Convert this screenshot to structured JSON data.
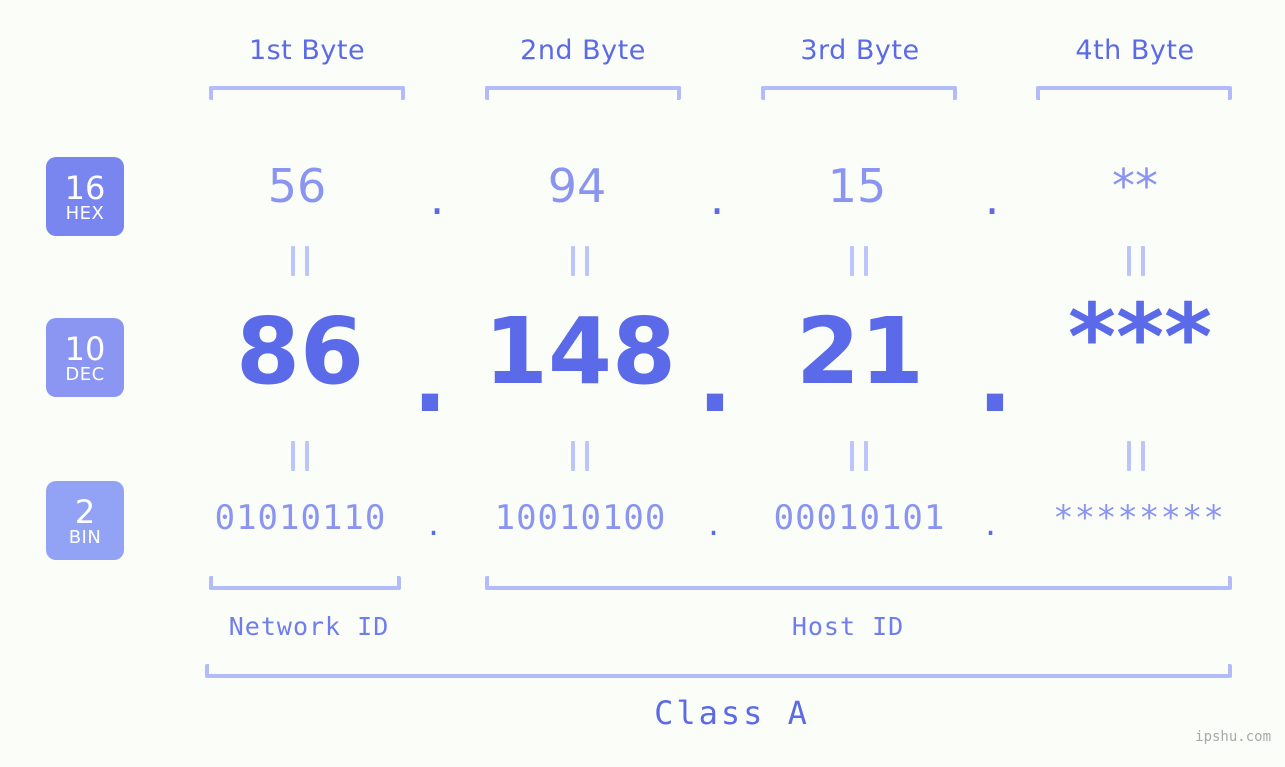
{
  "meta": {
    "background_color": "#fbfdf8",
    "accent_dark": "#5b6ae8",
    "accent_mid": "#8a95f2",
    "accent_light": "#b3bcfa",
    "watermark": "ipshu.com"
  },
  "headers": [
    {
      "label": "1st Byte"
    },
    {
      "label": "2nd Byte"
    },
    {
      "label": "3rd Byte"
    },
    {
      "label": "4th Byte"
    }
  ],
  "bases": [
    {
      "num": "16",
      "name": "HEX",
      "color": "#7986f0"
    },
    {
      "num": "10",
      "name": "DEC",
      "color": "#8a96f2"
    },
    {
      "num": "2",
      "name": "BIN",
      "color": "#92a3f5"
    }
  ],
  "separator": ".",
  "rows": {
    "hex": {
      "values": [
        "56",
        "94",
        "15",
        "**"
      ]
    },
    "dec": {
      "values": [
        "86",
        "148",
        "21",
        "***"
      ]
    },
    "bin": {
      "values": [
        "01010110",
        "10010100",
        "00010101",
        "********"
      ]
    }
  },
  "equals_mark": "||",
  "sections": {
    "network_id": "Network ID",
    "host_id": "Host ID",
    "class": "Class A"
  }
}
